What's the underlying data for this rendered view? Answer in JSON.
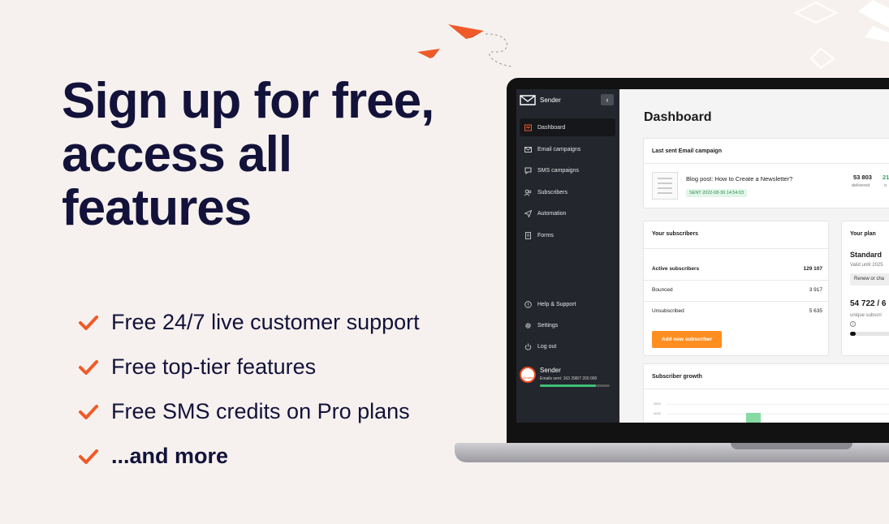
{
  "headline": {
    "line1": "Sign up for free,",
    "line2": "access all",
    "line3": "features"
  },
  "features": [
    {
      "text": "Free 24/7 live customer support",
      "bold": false
    },
    {
      "text": "Free top-tier features",
      "bold": false
    },
    {
      "text": "Free SMS credits on Pro plans",
      "bold": false
    },
    {
      "text": "...and more",
      "bold": true
    }
  ],
  "colors": {
    "accent": "#f05a28",
    "headline": "#13123a",
    "background": "#f6f1ee",
    "sidebar": "#23262d",
    "button": "#ff8e21",
    "success": "#2e8b52"
  },
  "app": {
    "brand": "Sender",
    "collapse_icon": "chevron-left-icon",
    "nav": [
      {
        "label": "Dashboard",
        "icon": "dashboard-icon",
        "active": true
      },
      {
        "label": "Email campaigns",
        "icon": "mail-icon",
        "active": false
      },
      {
        "label": "SMS campaigns",
        "icon": "sms-icon",
        "active": false
      },
      {
        "label": "Subscribers",
        "icon": "users-icon",
        "active": false
      },
      {
        "label": "Automation",
        "icon": "paper-plane-icon",
        "active": false
      },
      {
        "label": "Forms",
        "icon": "form-icon",
        "active": false
      }
    ],
    "nav_bottom": [
      {
        "label": "Help & Support",
        "icon": "help-icon"
      },
      {
        "label": "Settings",
        "icon": "gear-icon"
      },
      {
        "label": "Log out",
        "icon": "power-icon"
      }
    ],
    "user": {
      "avatar_label": "Sender",
      "name": "Sender",
      "emails_sent": "Emails sent: 163 298/7 200 000",
      "usage_fraction": 0.8
    }
  },
  "dashboard": {
    "title": "Dashboard",
    "last_campaign": {
      "title": "Last sent Email campaign",
      "name": "Blog post: How to Create a Newsletter?",
      "status": "SENT 2022-08-30 14:54:03",
      "delivered_value": "53 803",
      "delivered_label": "delivered",
      "second_value": "21",
      "second_label": "o"
    },
    "subscribers": {
      "title": "Your subscribers",
      "rows": [
        {
          "label": "Active subscribers",
          "value": "129 107"
        },
        {
          "label": "Bounced",
          "value": "3 917"
        },
        {
          "label": "Unsubscribed",
          "value": "5 635"
        }
      ],
      "add_button": "Add new subscriber"
    },
    "plan": {
      "title": "Your plan",
      "name": "Standard",
      "valid": "Valid until 2025",
      "renew_button": "Renew or cha",
      "count": "54 722 / 6",
      "unique_label": "unique subscri",
      "info_icon": "i"
    },
    "growth": {
      "title": "Subscriber growth",
      "ticks": [
        "4500",
        "4000"
      ]
    }
  }
}
